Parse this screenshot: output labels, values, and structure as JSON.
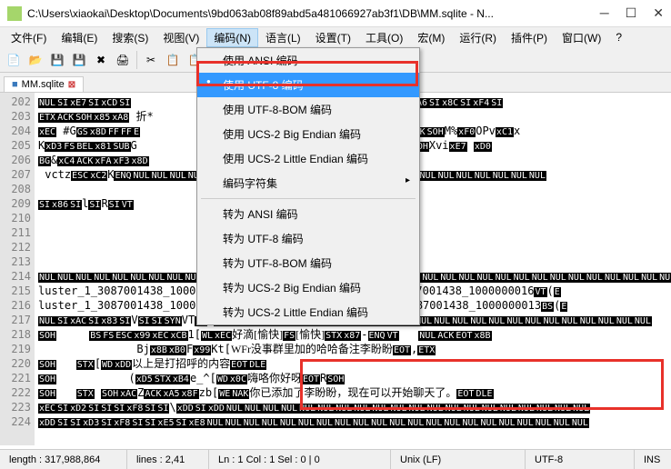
{
  "window": {
    "title": "C:\\Users\\xiaokai\\Desktop\\Documents\\9bd063ab08f89abd5a481066927ab3f1\\DB\\MM.sqlite - N..."
  },
  "menubar": {
    "items": [
      {
        "label": "文件(F)"
      },
      {
        "label": "编辑(E)"
      },
      {
        "label": "搜索(S)"
      },
      {
        "label": "视图(V)"
      },
      {
        "label": "编码(N)"
      },
      {
        "label": "语言(L)"
      },
      {
        "label": "设置(T)"
      },
      {
        "label": "工具(O)"
      },
      {
        "label": "宏(M)"
      },
      {
        "label": "运行(R)"
      },
      {
        "label": "插件(P)"
      },
      {
        "label": "窗口(W)"
      },
      {
        "label": "?"
      }
    ],
    "active_index": 4
  },
  "tab": {
    "label": "MM.sqlite"
  },
  "dropdown": {
    "items": [
      {
        "label": "使用 ANSI 编码",
        "type": "item"
      },
      {
        "label": "使用 UTF-8 编码",
        "type": "item",
        "selected": true
      },
      {
        "label": "使用 UTF-8-BOM 编码",
        "type": "item"
      },
      {
        "label": "使用 UCS-2 Big Endian 编码",
        "type": "item"
      },
      {
        "label": "使用 UCS-2 Little Endian 编码",
        "type": "item"
      },
      {
        "label": "编码字符集",
        "type": "submenu"
      },
      {
        "type": "sep"
      },
      {
        "label": "转为 ANSI 编码",
        "type": "item"
      },
      {
        "label": "转为 UTF-8 编码",
        "type": "item"
      },
      {
        "label": "转为 UTF-8-BOM 编码",
        "type": "item"
      },
      {
        "label": "转为 UCS-2 Big Endian 编码",
        "type": "item"
      },
      {
        "label": "转为 UCS-2 Little Endian 编码",
        "type": "item"
      }
    ]
  },
  "gutter": {
    "start": 202,
    "end": 224
  },
  "editor_lines": [
    {
      "n": 202,
      "html": "<span class='hex'>NUL</span><span class='hex'>SI</span><span class='hex'>xE7</span><span class='hex'>SI</span><span class='hex'>xCD</span><span class='hex'>SI</span>                                 <span class='hex'>NUL</span><span class='hex'>SI</span><span class='hex'>xC0</span><span class='hex'>SI</span><span class='hex'>xA6</span><span class='hex'>SI</span><span class='hex'>x8C</span><span class='hex'>SI</span><span class='hex'>xF4</span><span class='hex'>SI</span>"
    },
    {
      "n": 203,
      "html": "<span class='hex'>ETX</span><span class='hex'>ACK</span><span class='hex'>SOH</span><span class='hex'>x85</span><span class='hex'>xA8</span> 折*"
    },
    {
      "n": 204,
      "html": "<span class='hex'>xEC</span> #G<span class='hex'>GS</span><span class='hex'>x8D</span><span class='hex'>FF</span><span class='hex'>FF</span><span class='hex'>E</span>                                      <span class='hex'>ETX</span><span class='hex'>ACK</span><span class='hex'>SOH</span>M%<span class='hex'>xF0</span>OPv<span class='hex'>xC1</span>x"
    },
    {
      "n": 205,
      "html": "K<span class='hex'>xD3</span><span class='hex'>FS</span><span class='hex'>BEL</span><span class='hex'>x81</span><span class='hex'>SUB</span>G                                <span class='hex'>BS</span><span class='hex'>FF</span>ETX<span class='hex'>ACK</span><span class='hex'>SOH</span>Xvi<span class='hex'>xE7</span> <span class='hex'>xD0</span>"
    },
    {
      "n": 206,
      "html": "<span class='hex'>BG</span>&<span class='hex'>xC4</span><span class='hex'>ACK</span><span class='hex'>xFA</span><span class='hex'>xF3</span><span class='hex'>x8D</span>"
    },
    {
      "n": 207,
      "html": " vctz<span class='hex'>ESC</span><span class='hex'>xC2</span>K<span class='hex'>ENQ</span><span class='hex'>NUL</span><span class='hex'>NUL</span><span class='hex'>NUL</span><span class='hex'>NUL</span><span class='hex'>NUL</span><span class='hex'>NUL</span><span class='hex'>NUL</span><span class='hex'>NUL</span><span class='hex'>NUL</span><span class='hex'>NUL</span><span class='hex'>NUL</span><span class='hex'>NUL</span><span class='hex'>NUL</span><span class='hex'>SI</span><span class='hex'>xFB</span><span class='hex'>NUL</span><span class='hex'>NUL</span><span class='hex'>NUL</span><span class='hex'>NUL</span><span class='hex'>NUL</span><span class='hex'>NUL</span><span class='hex'>NUL</span><span class='hex'>NUL</span>"
    },
    {
      "n": 208,
      "html": ""
    },
    {
      "n": 209,
      "html": "<span class='hex'>SI</span><span class='hex'>x86</span><span class='hex'>SI</span>l<span class='hex'>SI</span>R<span class='hex'>SI</span><span class='hex'>VT</span>"
    },
    {
      "n": 210,
      "html": ""
    },
    {
      "n": 211,
      "html": ""
    },
    {
      "n": 212,
      "html": ""
    },
    {
      "n": 213,
      "html": ""
    },
    {
      "n": 214,
      "html": "<span class='hex'>NUL</span><span class='hex'>NUL</span><span class='hex'>NUL</span><span class='hex'>NUL</span><span class='hex'>NUL</span><span class='hex'>NUL</span><span class='hex'>NUL</span><span class='hex'>NUL</span><span class='hex'>NUL</span><span class='hex'>NUL</span><span class='hex'>NUL</span><span class='hex'>NUL</span><span class='hex'>NUL</span><span class='hex'>NUL</span><span class='hex'>NUL</span><span class='hex'>NUL</span><span class='hex'>NUL</span><span class='hex'>NUL</span><span class='hex'>NUL</span><span class='hex'>NUL</span><span class='hex'>NUL</span><span class='hex'>NUL</span><span class='hex'>NUL</span><span class='hex'>NUL</span><span class='hex'>NUL</span><span class='hex'>NUL</span><span class='hex'>NUL</span><span class='hex'>NUL</span><span class='hex'>NUL</span><span class='hex'>NUL</span><span class='hex'>NUL</span><span class='hex'>NUL</span><span class='hex'>NUL</span><span class='hex'>NUL</span><span class='hex'>NUL</span><span class='hex'>NUL</span>"
    },
    {
      "n": 215,
      "html": "luster_1_3087001438_1000000017<span class='hex'>FF</span>(<span class='hex'>ETX</span>U<span class='hex'>SOH</span>mmbizcluster_1_3087001438_1000000016<span class='hex'>VT</span>(<span class='hex'>E</span>"
    },
    {
      "n": 216,
      "html": "luster_1_3087001438_1000000011   (<span class='hex'>ETX</span>U<span class='hex'>SOH</span>mmbizcluster_1_3087001438_1000000013<span class='hex'>BS</span>(<span class='hex'>E</span>"
    },
    {
      "n": 217,
      "html": "<span class='hex'>NUL</span><span class='hex'>SI</span><span class='hex'>xAC</span><span class='hex'>SI</span><span class='hex'>x83</span><span class='hex'>SI</span>V<span class='hex'>SI</span><span class='hex'>SI</span><span class='hex'>SYN</span>VT<span class='hex'>FF</span> <span class='hex'>NUL</span><span class='hex'>NUL</span><span class='hex'>NUL</span><span class='hex'>NUL</span><span class='hex'>NUL</span><span class='hex'>NUL</span><span class='hex'>NUL</span><span class='hex'>NUL</span><span class='hex'>NUL</span><span class='hex'>NUL</span><span class='hex'>NUL</span><span class='hex'>NUL</span><span class='hex'>NUL</span><span class='hex'>NUL</span><span class='hex'>NUL</span><span class='hex'>NUL</span><span class='hex'>NUL</span><span class='hex'>NUL</span><span class='hex'>NUL</span><span class='hex'>NUL</span><span class='hex'>NUL</span><span class='hex'>NUL</span><span class='hex'>NUL</span><span class='hex'>NUL</span>"
    },
    {
      "n": 218,
      "html": "<span class='hex'>SOH</span>     <span class='hex'>BS</span><span class='hex'>FS</span><span class='hex'>ESC</span><span class='hex'>x99</span><span class='hex'>xEC</span><span class='hex'>xCB</span>1[<span class='hex'>WL</span><span class='hex'>xEC</span><span class='cn'>好滴[愉快]</span><span class='hex'>FS</span><span class='cn'>[愉快]</span><span class='hex'>STX</span><span class='hex'>x87</span>-<span class='hex'>ENQ</span><span class='hex'>VT</span>   <span class='hex'>NUL</span><span class='hex'>ACK</span><span class='hex'>EOT</span><span class='hex'>x8B</span>"
    },
    {
      "n": 219,
      "html": "               Bj<span class='hex'>x8B</span><span class='hex'>xB0</span>F<span class='hex'>x99</span>Kt[<span class='cn'>WFr没事群里加的哈哈备注李盼盼</span><span class='hex'>EOT</span>,<span class='hex'>ETX</span>"
    },
    {
      "n": 220,
      "html": "<span class='hex'>SOH</span>   <span class='hex'>STX</span>[<span class='hex'>WD</span><span class='hex'>xDD</span><span class='cn'>以上是打招呼的内容</span><span class='hex'>EOT</span><span class='hex'>DLE</span>"
    },
    {
      "n": 221,
      "html": "<span class='hex'>SOH</span>           (<span class='hex'>xD5</span><span class='hex'>STX</span><span class='hex'>xB4</span>e_^[<span class='hex'>WD</span><span class='hex'>x0C</span><span class='cn'>嗨咯你好呀</span><span class='hex'>EOT</span>R<span class='hex'>SOH</span>"
    },
    {
      "n": 222,
      "html": "<span class='hex'>SOH</span>   <span class='hex'>STX</span> <span class='hex'>SOH</span><span class='hex'>xAC</span>Z<span class='hex'>ACK</span><span class='hex'>xA5</span><span class='hex'>x8F</span>zb[<span class='hex'>WE</span><span class='hex'>NAK</span><span class='cn'>你已添加了李盼盼，现在可以开始聊天了。</span><span class='hex'>EOT</span><span class='hex'>DLE</span>"
    },
    {
      "n": 223,
      "html": "<span class='hex'>xEC</span><span class='hex'>SI</span><span class='hex'>xD2</span><span class='hex'>SI</span><span class='hex'>SI</span><span class='hex'>SI</span><span class='hex'>xF8</span><span class='hex'>SI</span><span class='hex'>SI</span>\\<span class='hex'>xDD</span><span class='hex'>SI</span><span class='hex'>xDD</span><span class='hex'>NUL</span><span class='hex'>NUL</span><span class='hex'>NUL</span><span class='hex'>NUL</span><span class='hex'>NUL</span><span class='hex'>NUL</span><span class='hex'>NUL</span><span class='hex'>NUL</span><span class='hex'>NUL</span><span class='hex'>NUL</span><span class='hex'>NUL</span><span class='hex'>NUL</span><span class='hex'>NUL</span><span class='hex'>NUL</span><span class='hex'>NUL</span><span class='hex'>NUL</span><span class='hex'>NUL</span><span class='hex'>NUL</span><span class='hex'>NUL</span><span class='hex'>NUL</span>"
    },
    {
      "n": 224,
      "html": "<span class='hex'>xDD</span><span class='hex'>SI</span><span class='hex'>SI</span><span class='hex'>xD3</span><span class='hex'>SI</span><span class='hex'>xF8</span><span class='hex'>SI</span><span class='hex'>SI</span><span class='hex'>xE5</span><span class='hex'>SI</span><span class='hex'>xE8</span><span class='hex'>NUL</span><span class='hex'>NUL</span><span class='hex'>NUL</span><span class='hex'>NUL</span><span class='hex'>NUL</span><span class='hex'>NUL</span><span class='hex'>NUL</span><span class='hex'>NUL</span><span class='hex'>NUL</span><span class='hex'>NUL</span><span class='hex'>NUL</span><span class='hex'>NUL</span><span class='hex'>NUL</span><span class='hex'>NUL</span><span class='hex'>NUL</span><span class='hex'>NUL</span><span class='hex'>NUL</span><span class='hex'>NUL</span><span class='hex'>NUL</span><span class='hex'>NUL</span><span class='hex'>NUL</span>"
    }
  ],
  "statusbar": {
    "length": "length : 317,988,864",
    "lines": "lines : 2,41",
    "pos": "Ln : 1    Col : 1    Sel : 0 | 0",
    "eol": "Unix (LF)",
    "enc": "UTF-8",
    "ins": "INS"
  }
}
